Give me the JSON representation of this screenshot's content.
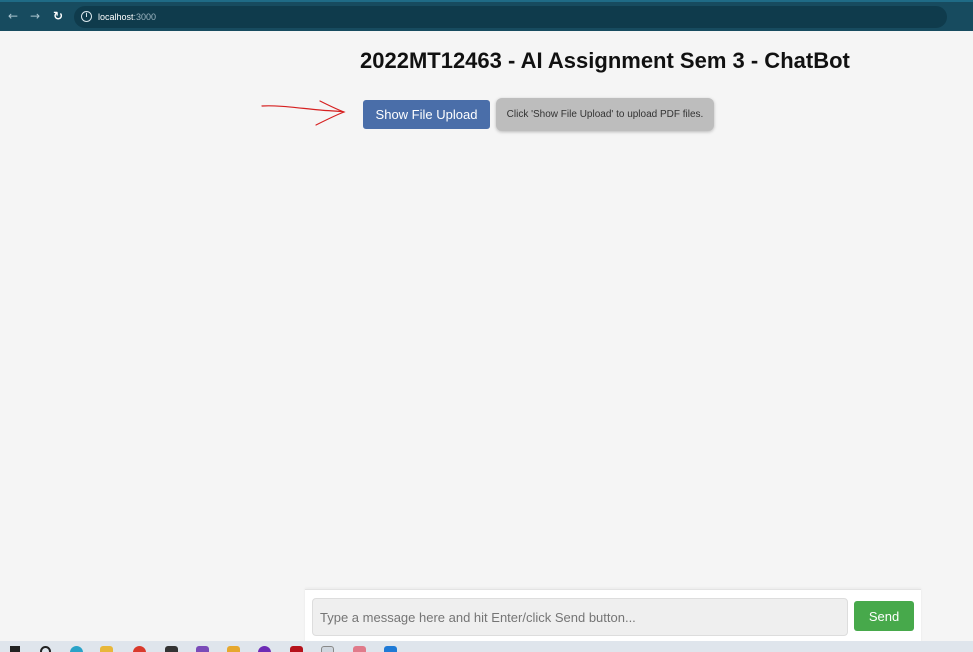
{
  "browser": {
    "url_host": "localhost",
    "url_port": ":3000",
    "icons": [
      "back-arrow-icon",
      "forward-arrow-icon",
      "reload-icon",
      "site-info-icon"
    ]
  },
  "page": {
    "title": "2022MT12463 - AI Assignment Sem 3 - ChatBot",
    "show_upload_label": "Show File Upload",
    "hint_text": "Click 'Show File Upload' to upload PDF files.",
    "annotation_color": "#d62020"
  },
  "chat": {
    "input_value": "",
    "input_placeholder": "Type a message here and hit Enter/click Send button...",
    "send_label": "Send"
  },
  "colors": {
    "browser_bar": "#174b5f",
    "primary_button": "#4a6ea9",
    "send_button": "#47a94b",
    "hint_box": "#bdbdbd"
  },
  "taskbar": {
    "icons": [
      "windows-start-icon",
      "search-icon",
      "edge-icon",
      "file-explorer-icon",
      "chrome-icon",
      "terminal-icon",
      "visual-studio-icon",
      "app-icon",
      "app-icon",
      "app-icon",
      "notepad-icon",
      "app-icon",
      "vscode-icon"
    ]
  }
}
